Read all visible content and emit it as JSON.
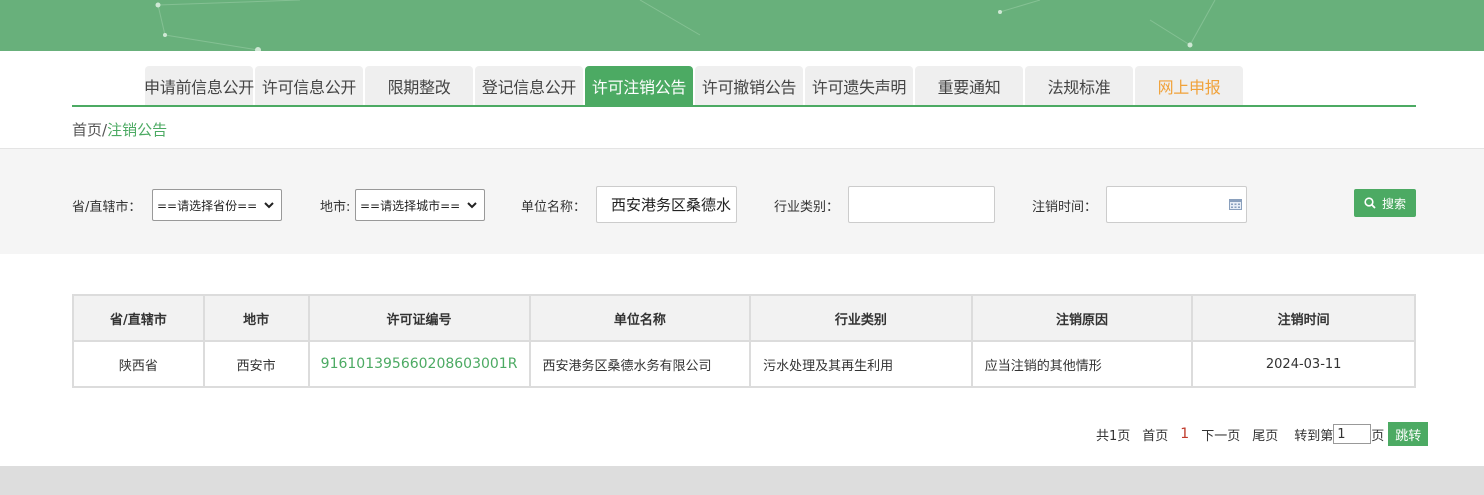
{
  "nav": {
    "tabs": [
      {
        "label": "申请前信息公开"
      },
      {
        "label": "许可信息公开"
      },
      {
        "label": "限期整改"
      },
      {
        "label": "登记信息公开"
      },
      {
        "label": "许可注销公告",
        "active": true
      },
      {
        "label": "许可撤销公告"
      },
      {
        "label": "许可遗失声明"
      },
      {
        "label": "重要通知"
      },
      {
        "label": "法规标准"
      },
      {
        "label": "网上申报"
      }
    ]
  },
  "breadcrumb": {
    "home": "首页",
    "separator": "/",
    "current": "注销公告"
  },
  "search": {
    "province_label": "省/直辖市：",
    "province_value": "==请选择省份==",
    "city_label": "地市:",
    "city_value": "==请选择城市==",
    "unit_label": "单位名称：",
    "unit_value": "西安港务区桑德水",
    "industry_label": "行业类别：",
    "industry_value": "",
    "cancel_time_label": "注销时间：",
    "cancel_time_value": "",
    "search_button": "搜索"
  },
  "table": {
    "headers": [
      "省/直辖市",
      "地市",
      "许可证编号",
      "单位名称",
      "行业类别",
      "注销原因",
      "注销时间"
    ],
    "rows": [
      {
        "province": "陕西省",
        "city": "西安市",
        "license_no": "916101395660208603001R",
        "unit_name": "西安港务区桑德水务有限公司",
        "industry": "污水处理及其再生利用",
        "reason": "应当注销的其他情形",
        "date": "2024-03-11"
      }
    ]
  },
  "pagination": {
    "total": "共1页",
    "first": "首页",
    "current": "1",
    "next": "下一页",
    "last": "尾页",
    "goto_label": "转到第",
    "goto_value": "1",
    "page_unit": "页",
    "jump_button": "跳转"
  },
  "colors": {
    "brand_green": "#4caa63",
    "banner_green": "#68b07b",
    "report_orange": "#f0a23a",
    "current_page_red": "#c0392b"
  }
}
